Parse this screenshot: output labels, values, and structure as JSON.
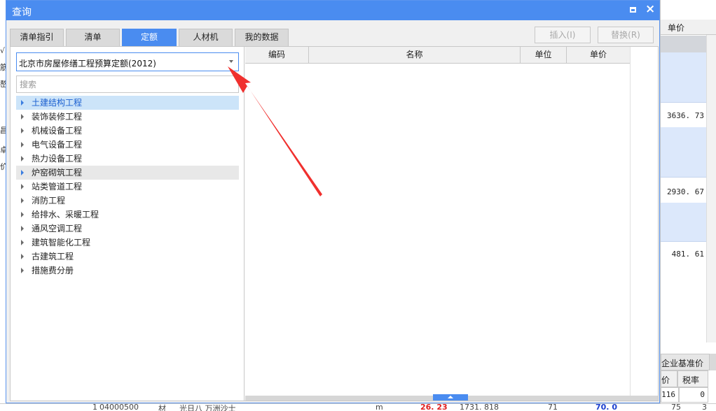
{
  "dialog": {
    "title": "查询",
    "tabs": [
      {
        "label": "清单指引",
        "active": false
      },
      {
        "label": "清单",
        "active": false
      },
      {
        "label": "定额",
        "active": true
      },
      {
        "label": "人材机",
        "active": false
      },
      {
        "label": "我的数据",
        "active": false
      }
    ],
    "insert_label": "插入(I)",
    "replace_label": "替换(R)",
    "quota_library": "北京市房屋修缮工程预算定额(2012)",
    "search_placeholder": "搜索",
    "tree": [
      "土建结构工程",
      "装饰装修工程",
      "机械设备工程",
      "电气设备工程",
      "热力设备工程",
      "炉窑砌筑工程",
      "站类管道工程",
      "消防工程",
      "给排水、采暖工程",
      "通风空调工程",
      "建筑智能化工程",
      "古建筑工程",
      "措施费分册"
    ],
    "columns": [
      "编码",
      "名称",
      "单位",
      "单价"
    ]
  },
  "background": {
    "price_header": "单价",
    "values": [
      "3636. 73",
      "2930. 67",
      "481. 61"
    ],
    "bottom_tab": "企业基准价",
    "col_price": "价",
    "col_tax": "税率",
    "cell_a": "116",
    "cell_b": "0",
    "cell_c": "75",
    "cell_d": "3",
    "left_glyphs": [
      "√",
      "筋",
      "嶅",
      "昌",
      "卓",
      "价"
    ],
    "bottom_texts": [
      "1",
      "04000500",
      "材",
      "光日八 万洲沙士",
      "m",
      "26. 23",
      "1731. 818",
      "71",
      "70. 0"
    ]
  },
  "colors": {
    "accent": "#4a8cf0",
    "selected_row": "#cce4f9",
    "annotation_arrow": "#f0302e"
  }
}
